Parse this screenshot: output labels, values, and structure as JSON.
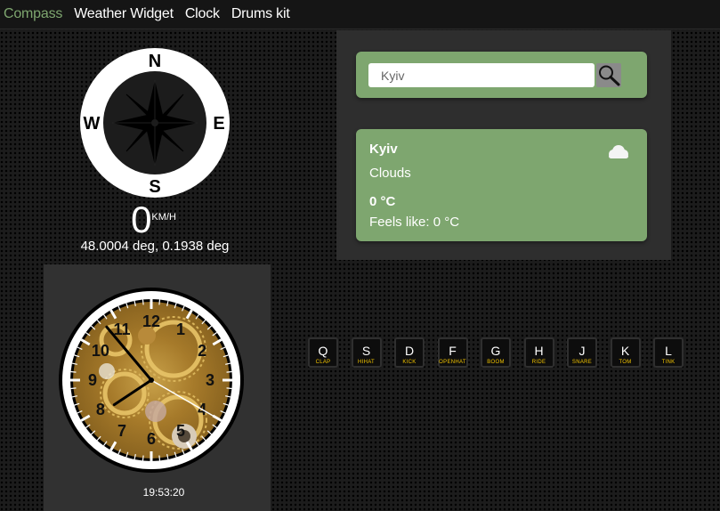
{
  "nav": {
    "items": [
      {
        "label": "Compass",
        "active": true
      },
      {
        "label": "Weather Widget",
        "active": false
      },
      {
        "label": "Clock",
        "active": false
      },
      {
        "label": "Drums kit",
        "active": false
      }
    ]
  },
  "compass": {
    "cardinals": {
      "n": "N",
      "e": "E",
      "s": "S",
      "w": "W"
    },
    "speed": "0",
    "speed_unit": "KM/H",
    "coordinates": "48.0004 deg, 0.1938 deg"
  },
  "weather": {
    "search": {
      "value": "Kyiv",
      "placeholder": "Kyiv"
    },
    "city": "Kyiv",
    "description": "Clouds",
    "temperature": "0 °C",
    "feels_like": "Feels like: 0 °C",
    "icon": "cloud-icon"
  },
  "clock": {
    "numbers": [
      "12",
      "1",
      "2",
      "3",
      "4",
      "5",
      "6",
      "7",
      "8",
      "9",
      "10",
      "11"
    ],
    "time": "19:53:20"
  },
  "drums": {
    "keys": [
      {
        "key": "Q",
        "sound": "CLAP"
      },
      {
        "key": "S",
        "sound": "HIHAT"
      },
      {
        "key": "D",
        "sound": "KICK"
      },
      {
        "key": "F",
        "sound": "OPENHAT"
      },
      {
        "key": "G",
        "sound": "BOOM"
      },
      {
        "key": "H",
        "sound": "RIDE"
      },
      {
        "key": "J",
        "sound": "SNARE"
      },
      {
        "key": "K",
        "sound": "TOM"
      },
      {
        "key": "L",
        "sound": "TINK"
      }
    ]
  },
  "colors": {
    "accent_green": "#7ea66f",
    "drum_label_yellow": "#f2c400",
    "clock_gold": "#b8923a"
  }
}
